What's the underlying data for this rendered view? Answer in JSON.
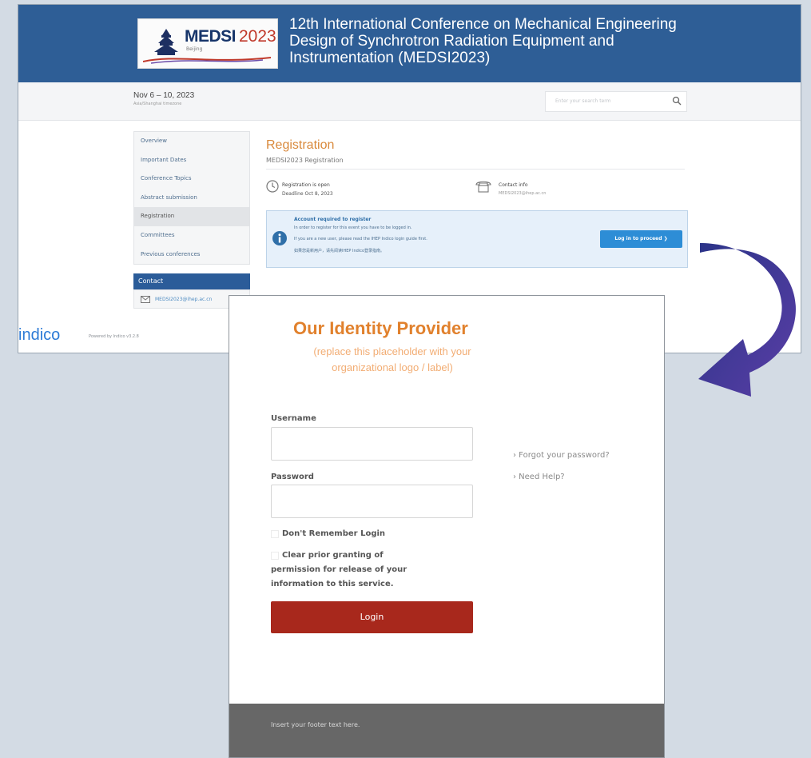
{
  "indico": {
    "logo": {
      "brand": "MEDSI",
      "year": "2023",
      "city": "Beijing"
    },
    "conference_title": "12th International Conference on Mechanical Engineering Design of Synchrotron Radiation Equipment and Instrumentation (MEDSI2023)",
    "dates": "Nov 6 – 10, 2023",
    "dates_sub": "Asia/Shanghai timezone",
    "search_placeholder": "Enter your search term",
    "menu": [
      "Overview",
      "Important Dates",
      "Conference Topics",
      "Abstract submission",
      "Registration",
      "Committees",
      "Previous conferences"
    ],
    "menu_active_index": 4,
    "contact_heading": "Contact",
    "contact_email": "MEDSI2023@ihep.ac.cn",
    "registration_title": "Registration",
    "registration_subtitle": "MEDSI2023 Registration",
    "registration_status": "Registration is open",
    "registration_deadline": "Deadline Oct 8, 2023",
    "contact_info_label": "Contact info",
    "contact_info_email": "MEDSI2023@ihep.ac.cn",
    "notice": {
      "heading": "Account required to register",
      "line1": "In order to register for this event you have to be logged in.",
      "line2": "If you are a new user, please read the IHEP Indico login guide first.",
      "line3": "如果您是新用户，请先阅读IHEP Indico登录指南。",
      "button": "Log in to proceed ❯"
    },
    "footer_logo": "indico",
    "powered_by": "Powered by Indico v3.2.8"
  },
  "idp": {
    "title": "Our Identity Provider",
    "subtitle_line1": "(replace this placeholder with your",
    "subtitle_line2": "organizational logo / label)",
    "username_label": "Username",
    "password_label": "Password",
    "dont_remember": "Don't Remember Login",
    "clear_line1": "Clear prior granting of",
    "clear_line2": "permission for release of your",
    "clear_line3": "information to this service.",
    "login_button": "Login",
    "forgot_password": "› Forgot your password?",
    "need_help": "› Need Help?",
    "footer": "Insert your footer text here."
  },
  "colors": {
    "banner": "#2e5e96",
    "registration_accent": "#d9893b",
    "login_button": "#a8281c",
    "idp_title": "#e1812d",
    "arrow": "#2f3a8e"
  }
}
